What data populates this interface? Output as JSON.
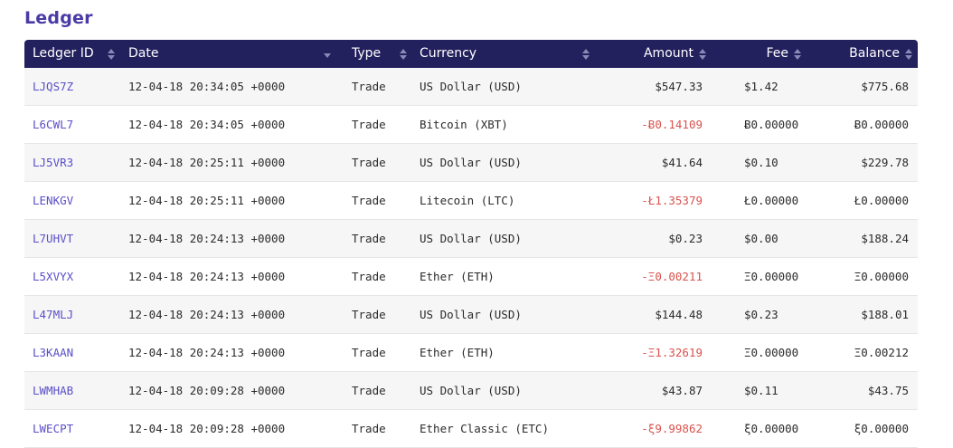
{
  "page": {
    "title": "Ledger"
  },
  "table": {
    "columns": {
      "id": "Ledger ID",
      "date": "Date",
      "type": "Type",
      "currency": "Currency",
      "amount": "Amount",
      "fee": "Fee",
      "balance": "Balance"
    },
    "rows": [
      {
        "id": "LJQS7Z",
        "date": "12-04-18 20:34:05 +0000",
        "type": "Trade",
        "currency": "US Dollar (USD)",
        "amount": "$547.33",
        "amount_negative": false,
        "fee": "$1.42",
        "balance": "$775.68"
      },
      {
        "id": "L6CWL7",
        "date": "12-04-18 20:34:05 +0000",
        "type": "Trade",
        "currency": "Bitcoin (XBT)",
        "amount": "-Ƀ0.14109",
        "amount_negative": true,
        "fee": "Ƀ0.00000",
        "balance": "Ƀ0.00000"
      },
      {
        "id": "LJ5VR3",
        "date": "12-04-18 20:25:11 +0000",
        "type": "Trade",
        "currency": "US Dollar (USD)",
        "amount": "$41.64",
        "amount_negative": false,
        "fee": "$0.10",
        "balance": "$229.78"
      },
      {
        "id": "LENKGV",
        "date": "12-04-18 20:25:11 +0000",
        "type": "Trade",
        "currency": "Litecoin (LTC)",
        "amount": "-Ł1.35379",
        "amount_negative": true,
        "fee": "Ł0.00000",
        "balance": "Ł0.00000"
      },
      {
        "id": "L7UHVT",
        "date": "12-04-18 20:24:13 +0000",
        "type": "Trade",
        "currency": "US Dollar (USD)",
        "amount": "$0.23",
        "amount_negative": false,
        "fee": "$0.00",
        "balance": "$188.24"
      },
      {
        "id": "L5XVYX",
        "date": "12-04-18 20:24:13 +0000",
        "type": "Trade",
        "currency": "Ether (ETH)",
        "amount": "-Ξ0.00211",
        "amount_negative": true,
        "fee": "Ξ0.00000",
        "balance": "Ξ0.00000"
      },
      {
        "id": "L47MLJ",
        "date": "12-04-18 20:24:13 +0000",
        "type": "Trade",
        "currency": "US Dollar (USD)",
        "amount": "$144.48",
        "amount_negative": false,
        "fee": "$0.23",
        "balance": "$188.01"
      },
      {
        "id": "L3KAAN",
        "date": "12-04-18 20:24:13 +0000",
        "type": "Trade",
        "currency": "Ether (ETH)",
        "amount": "-Ξ1.32619",
        "amount_negative": true,
        "fee": "Ξ0.00000",
        "balance": "Ξ0.00212"
      },
      {
        "id": "LWMHAB",
        "date": "12-04-18 20:09:28 +0000",
        "type": "Trade",
        "currency": "US Dollar (USD)",
        "amount": "$43.87",
        "amount_negative": false,
        "fee": "$0.11",
        "balance": "$43.75"
      },
      {
        "id": "LWECPT",
        "date": "12-04-18 20:09:28 +0000",
        "type": "Trade",
        "currency": "Ether Classic (ETC)",
        "amount": "-ξ9.99862",
        "amount_negative": true,
        "fee": "ξ0.00000",
        "balance": "ξ0.00000"
      }
    ]
  },
  "colors": {
    "header_bg": "#23205e",
    "title": "#4a3aa5",
    "link": "#5a4fc7",
    "negative": "#d9534f"
  }
}
